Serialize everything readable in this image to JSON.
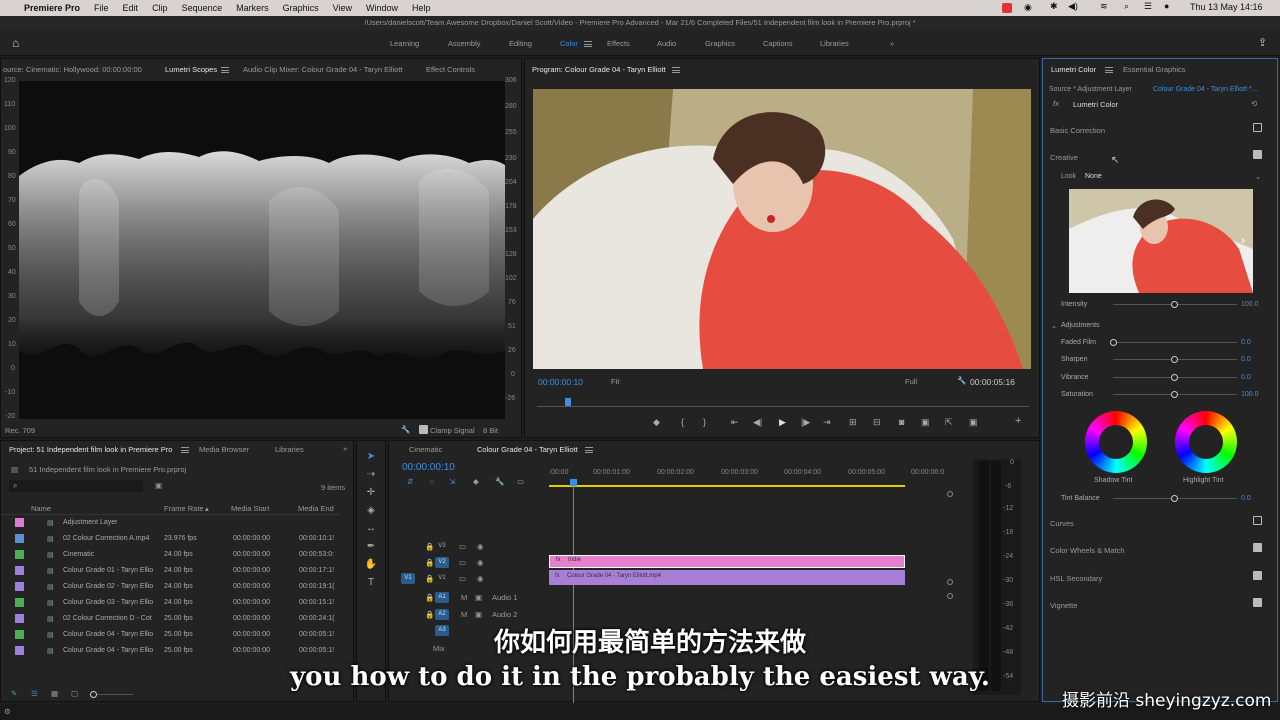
{
  "menubar": {
    "app": "Premiere Pro",
    "items": [
      "File",
      "Edit",
      "Clip",
      "Sequence",
      "Markers",
      "Graphics",
      "View",
      "Window",
      "Help"
    ],
    "clock": "Thu 13 May  14:16"
  },
  "titlebar": {
    "path": "/Users/danielscott/Team Awesome Dropbox/Daniel Scott/Video - Premiere Pro Advanced - Mar 21/6 Completed Files/51 Independent film look in Premiere Pro.prproj *"
  },
  "workspaces": [
    "Learning",
    "Assembly",
    "Editing",
    "Color",
    "Effects",
    "Audio",
    "Graphics",
    "Captions",
    "Libraries"
  ],
  "active_workspace": "Color",
  "scopes": {
    "tabs": [
      "ource: Cinematic: Hollywood: 00:00:00:00",
      "Lumetri Scopes",
      "Audio Clip Mixer: Colour Grade 04 - Taryn Elliott",
      "Effect Controls"
    ],
    "left_ticks": [
      "120",
      "110",
      "100",
      "90",
      "80",
      "70",
      "60",
      "50",
      "40",
      "30",
      "20",
      "10",
      "0",
      "-10",
      "-20"
    ],
    "right_ticks": [
      "306",
      "280",
      "255",
      "230",
      "204",
      "178",
      "153",
      "128",
      "102",
      "76",
      "51",
      "26",
      "0",
      "-26"
    ],
    "footer_left": "Rec. 709",
    "clamp": "Clamp Signal",
    "bits": "8 Bit"
  },
  "program": {
    "title": "Program: Colour Grade 04 - Taryn Elliott",
    "timecode": "00:00:00:10",
    "fit": "Fit",
    "quality": "Full",
    "duration": "00:00:05:16"
  },
  "project": {
    "tabs": [
      "Project: 51 Independent film look in Premiere Pro",
      "Media Browser",
      "Libraries"
    ],
    "file": "51 Independent film look in Premiere Pro.prproj",
    "items_count": "9 items",
    "columns": [
      "Name",
      "Frame Rate",
      "Media Start",
      "Media End"
    ],
    "rows": [
      {
        "color": "#e07ad8",
        "name": "Adjustment Layer",
        "fps": "",
        "start": "",
        "end": ""
      },
      {
        "color": "#5b8fd6",
        "name": "02 Colour Correction A.mp4",
        "fps": "23.976 fps",
        "start": "00:00:00:00",
        "end": "00:00:10:1!"
      },
      {
        "color": "#4caf50",
        "name": "Cinematic",
        "fps": "24.00 fps",
        "start": "00:00:00:00",
        "end": "00:00:53:0:"
      },
      {
        "color": "#a07fe0",
        "name": "Colour Grade 01 - Taryn Ellio",
        "fps": "24.00 fps",
        "start": "00:00:00:00",
        "end": "00:00:17:1!"
      },
      {
        "color": "#a07fe0",
        "name": "Colour Grade 02 - Taryn Ellio",
        "fps": "24.00 fps",
        "start": "00:00:00:00",
        "end": "00:00:19:1("
      },
      {
        "color": "#4caf50",
        "name": "Colour Grade 03 - Taryn Ellio",
        "fps": "24.00 fps",
        "start": "00:00:00:00",
        "end": "00:00:15:1!"
      },
      {
        "color": "#a07fe0",
        "name": "02 Colour Correction D - Cot",
        "fps": "25.00 fps",
        "start": "00:00:00:00",
        "end": "00:00:24:1("
      },
      {
        "color": "#4caf50",
        "name": "Colour Grade 04 - Taryn Ellio",
        "fps": "25.00 fps",
        "start": "00:00:00:00",
        "end": "00:00:05:1!"
      },
      {
        "color": "#a07fe0",
        "name": "Colour Grade 04 - Taryn Ellio",
        "fps": "25.00 fps",
        "start": "00:00:00:00",
        "end": "00:00:05:1!"
      }
    ]
  },
  "timeline": {
    "tabs": [
      "Cinematic",
      "Colour Grade 04 - Taryn Elliott"
    ],
    "timecode": "00:00:00:10",
    "ruler": [
      ":00:00",
      "00:00:01:00",
      "00:00:02:00",
      "00:00:03:00",
      "00:00:04:00",
      "00:00:05:00",
      "00:00:06:0"
    ],
    "tracks": [
      "V3",
      "V2",
      "V1",
      "A1",
      "A2",
      "A3"
    ],
    "audio_names": [
      "Audio 1",
      "Audio 2"
    ],
    "mix": "Mix",
    "clip_v2": "Indie",
    "clip_v1": "Colour Grade 04 - Taryn Elliott.mp4",
    "meter_ticks": [
      "0",
      "-6",
      "-12",
      "-18",
      "-24",
      "-30",
      "-36",
      "-42",
      "-48",
      "-54"
    ]
  },
  "lumetri": {
    "tabs": [
      "Lumetri Color",
      "Essential Graphics"
    ],
    "source": "Source * Adjustment Layer",
    "target": "Colour Grade 04 - Taryn Elliott *...",
    "fx": "Lumetri Color",
    "sections": {
      "basic": "Basic Correction",
      "creative": "Creative",
      "curves": "Curves",
      "wheels": "Color Wheels & Match",
      "hsl": "HSL Secondary",
      "vignette": "Vignette"
    },
    "look_label": "Look",
    "look_value": "None",
    "intensity_label": "Intensity",
    "intensity": "100.0",
    "adjustments": "Adjustments",
    "sliders": [
      {
        "label": "Faded Film",
        "value": "0.0"
      },
      {
        "label": "Sharpen",
        "value": "0.0"
      },
      {
        "label": "Vibrance",
        "value": "0.0"
      },
      {
        "label": "Saturation",
        "value": "100.0"
      }
    ],
    "shadow_tint": "Shadow Tint",
    "highlight_tint": "Highlight Tint",
    "tint_balance": "Tint Balance",
    "tint_balance_value": "0.0"
  },
  "subtitles": {
    "zh": "你如何用最简单的方法来做",
    "en": "you how to do it in the probably the easiest way."
  },
  "watermark": "摄影前沿 sheyingzyz.com"
}
